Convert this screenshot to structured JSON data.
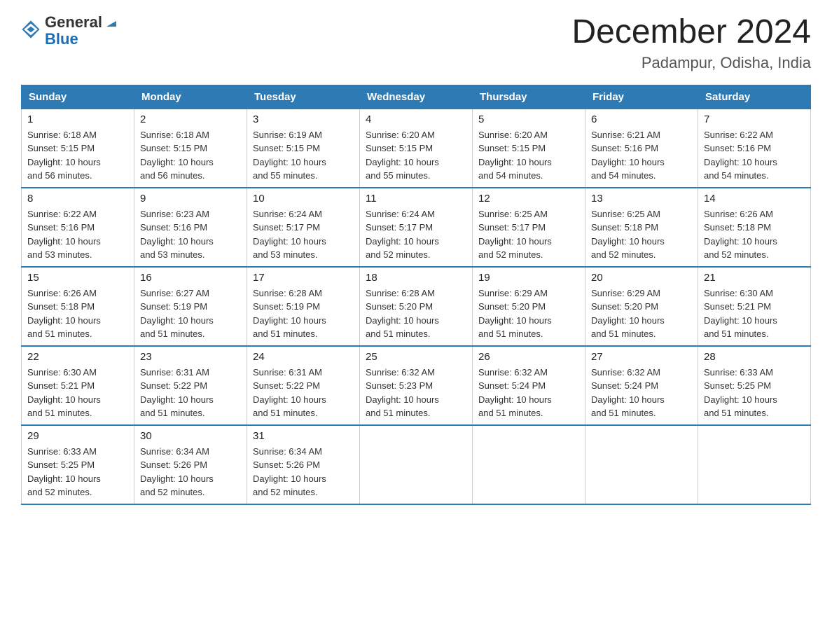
{
  "logo": {
    "general": "General",
    "blue": "Blue"
  },
  "title": "December 2024",
  "subtitle": "Padampur, Odisha, India",
  "days_of_week": [
    "Sunday",
    "Monday",
    "Tuesday",
    "Wednesday",
    "Thursday",
    "Friday",
    "Saturday"
  ],
  "weeks": [
    [
      {
        "day": "1",
        "sunrise": "6:18 AM",
        "sunset": "5:15 PM",
        "daylight": "10 hours and 56 minutes."
      },
      {
        "day": "2",
        "sunrise": "6:18 AM",
        "sunset": "5:15 PM",
        "daylight": "10 hours and 56 minutes."
      },
      {
        "day": "3",
        "sunrise": "6:19 AM",
        "sunset": "5:15 PM",
        "daylight": "10 hours and 55 minutes."
      },
      {
        "day": "4",
        "sunrise": "6:20 AM",
        "sunset": "5:15 PM",
        "daylight": "10 hours and 55 minutes."
      },
      {
        "day": "5",
        "sunrise": "6:20 AM",
        "sunset": "5:15 PM",
        "daylight": "10 hours and 54 minutes."
      },
      {
        "day": "6",
        "sunrise": "6:21 AM",
        "sunset": "5:16 PM",
        "daylight": "10 hours and 54 minutes."
      },
      {
        "day": "7",
        "sunrise": "6:22 AM",
        "sunset": "5:16 PM",
        "daylight": "10 hours and 54 minutes."
      }
    ],
    [
      {
        "day": "8",
        "sunrise": "6:22 AM",
        "sunset": "5:16 PM",
        "daylight": "10 hours and 53 minutes."
      },
      {
        "day": "9",
        "sunrise": "6:23 AM",
        "sunset": "5:16 PM",
        "daylight": "10 hours and 53 minutes."
      },
      {
        "day": "10",
        "sunrise": "6:24 AM",
        "sunset": "5:17 PM",
        "daylight": "10 hours and 53 minutes."
      },
      {
        "day": "11",
        "sunrise": "6:24 AM",
        "sunset": "5:17 PM",
        "daylight": "10 hours and 52 minutes."
      },
      {
        "day": "12",
        "sunrise": "6:25 AM",
        "sunset": "5:17 PM",
        "daylight": "10 hours and 52 minutes."
      },
      {
        "day": "13",
        "sunrise": "6:25 AM",
        "sunset": "5:18 PM",
        "daylight": "10 hours and 52 minutes."
      },
      {
        "day": "14",
        "sunrise": "6:26 AM",
        "sunset": "5:18 PM",
        "daylight": "10 hours and 52 minutes."
      }
    ],
    [
      {
        "day": "15",
        "sunrise": "6:26 AM",
        "sunset": "5:18 PM",
        "daylight": "10 hours and 51 minutes."
      },
      {
        "day": "16",
        "sunrise": "6:27 AM",
        "sunset": "5:19 PM",
        "daylight": "10 hours and 51 minutes."
      },
      {
        "day": "17",
        "sunrise": "6:28 AM",
        "sunset": "5:19 PM",
        "daylight": "10 hours and 51 minutes."
      },
      {
        "day": "18",
        "sunrise": "6:28 AM",
        "sunset": "5:20 PM",
        "daylight": "10 hours and 51 minutes."
      },
      {
        "day": "19",
        "sunrise": "6:29 AM",
        "sunset": "5:20 PM",
        "daylight": "10 hours and 51 minutes."
      },
      {
        "day": "20",
        "sunrise": "6:29 AM",
        "sunset": "5:20 PM",
        "daylight": "10 hours and 51 minutes."
      },
      {
        "day": "21",
        "sunrise": "6:30 AM",
        "sunset": "5:21 PM",
        "daylight": "10 hours and 51 minutes."
      }
    ],
    [
      {
        "day": "22",
        "sunrise": "6:30 AM",
        "sunset": "5:21 PM",
        "daylight": "10 hours and 51 minutes."
      },
      {
        "day": "23",
        "sunrise": "6:31 AM",
        "sunset": "5:22 PM",
        "daylight": "10 hours and 51 minutes."
      },
      {
        "day": "24",
        "sunrise": "6:31 AM",
        "sunset": "5:22 PM",
        "daylight": "10 hours and 51 minutes."
      },
      {
        "day": "25",
        "sunrise": "6:32 AM",
        "sunset": "5:23 PM",
        "daylight": "10 hours and 51 minutes."
      },
      {
        "day": "26",
        "sunrise": "6:32 AM",
        "sunset": "5:24 PM",
        "daylight": "10 hours and 51 minutes."
      },
      {
        "day": "27",
        "sunrise": "6:32 AM",
        "sunset": "5:24 PM",
        "daylight": "10 hours and 51 minutes."
      },
      {
        "day": "28",
        "sunrise": "6:33 AM",
        "sunset": "5:25 PM",
        "daylight": "10 hours and 51 minutes."
      }
    ],
    [
      {
        "day": "29",
        "sunrise": "6:33 AM",
        "sunset": "5:25 PM",
        "daylight": "10 hours and 52 minutes."
      },
      {
        "day": "30",
        "sunrise": "6:34 AM",
        "sunset": "5:26 PM",
        "daylight": "10 hours and 52 minutes."
      },
      {
        "day": "31",
        "sunrise": "6:34 AM",
        "sunset": "5:26 PM",
        "daylight": "10 hours and 52 minutes."
      },
      null,
      null,
      null,
      null
    ]
  ],
  "labels": {
    "sunrise": "Sunrise:",
    "sunset": "Sunset:",
    "daylight": "Daylight:"
  }
}
